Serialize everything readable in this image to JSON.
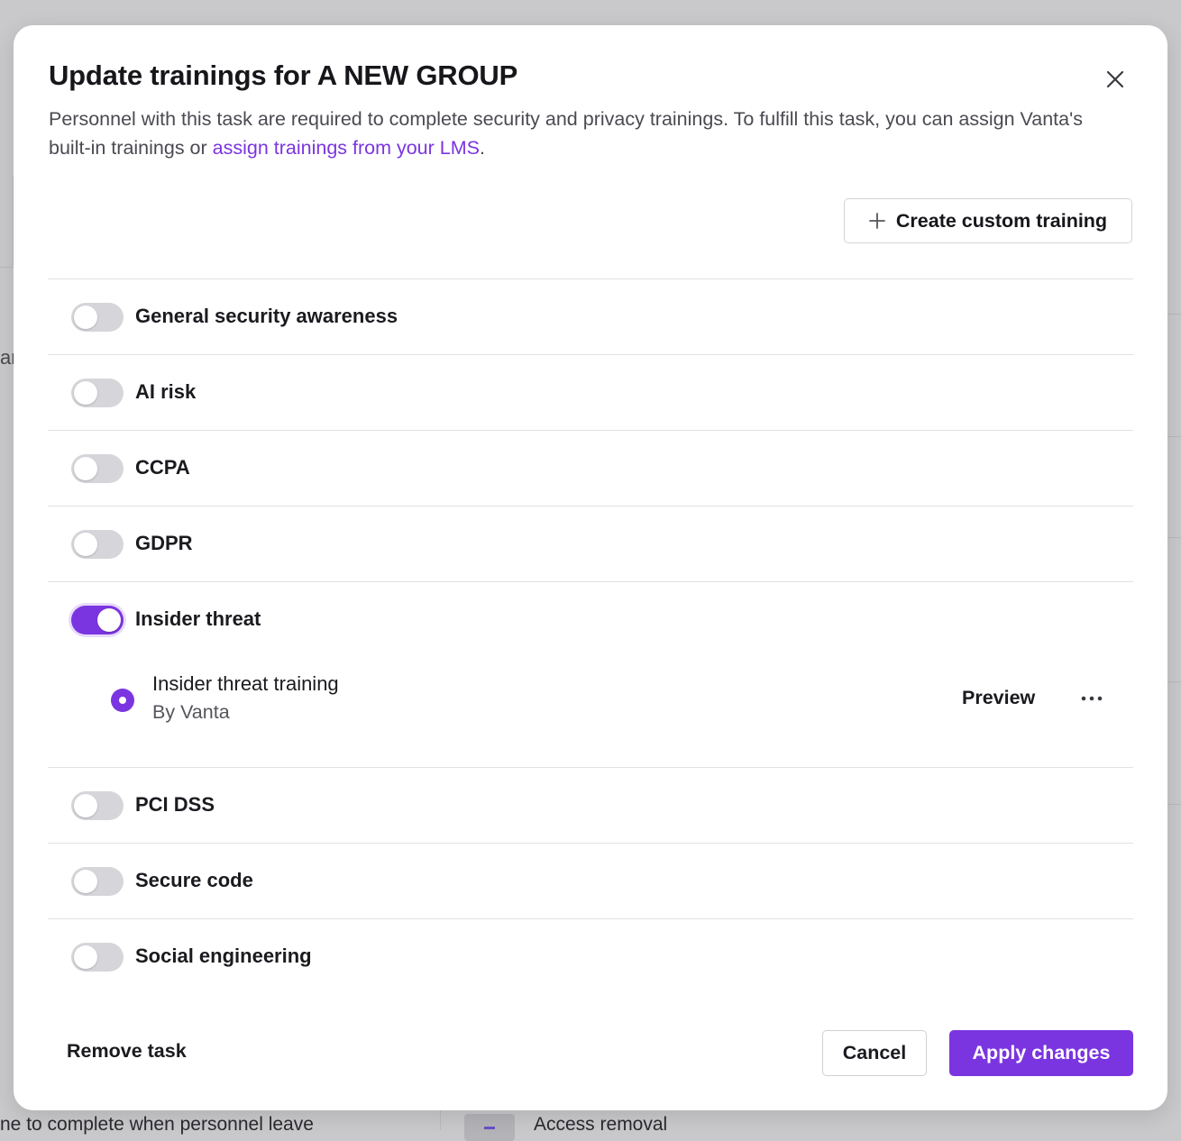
{
  "background": {
    "left_fragment": "ar",
    "bottom_left_text": "ne to complete when personnel leave",
    "bottom_right_text": "Access removal"
  },
  "modal": {
    "title": "Update trainings for A NEW GROUP",
    "description_text": "Personnel with this task are required to complete security and privacy trainings. To fulfill this task, you can assign Vanta's built-in trainings or ",
    "description_link": "assign trainings from your LMS",
    "description_end": ".",
    "create_button_label": "Create custom training",
    "trainings": [
      {
        "label": "General security awareness",
        "enabled": false
      },
      {
        "label": "AI risk",
        "enabled": false
      },
      {
        "label": "CCPA",
        "enabled": false
      },
      {
        "label": "GDPR",
        "enabled": false
      },
      {
        "label": "Insider threat",
        "enabled": true,
        "option": {
          "title": "Insider threat training",
          "meta": "By Vanta",
          "selected": true,
          "preview_label": "Preview"
        }
      },
      {
        "label": "PCI DSS",
        "enabled": false
      },
      {
        "label": "Secure code",
        "enabled": false
      },
      {
        "label": "Social engineering",
        "enabled": false
      }
    ],
    "footer": {
      "remove_label": "Remove task",
      "cancel_label": "Cancel",
      "apply_label": "Apply changes"
    }
  },
  "colors": {
    "accent": "#7b35e0",
    "toggle_off": "#d6d6da",
    "overlay": "#c9c9cb"
  }
}
